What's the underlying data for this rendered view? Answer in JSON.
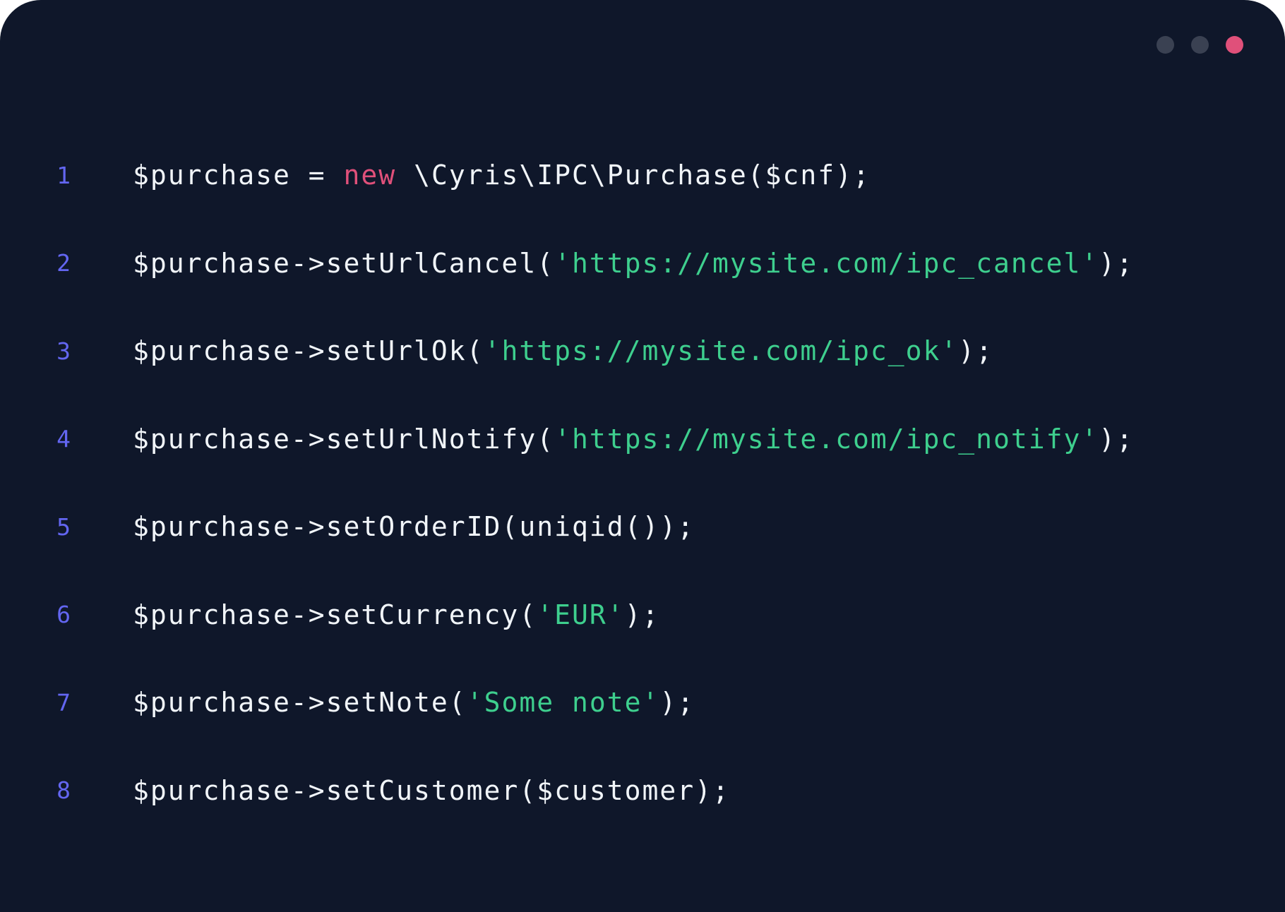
{
  "window_controls": [
    {
      "name": "minimize-dot",
      "color": "#3a4152"
    },
    {
      "name": "maximize-dot",
      "color": "#3a4152"
    },
    {
      "name": "close-dot",
      "color": "#e0507a"
    }
  ],
  "colors": {
    "background": "#0f172a",
    "line_number": "#6366f1",
    "default": "#f1f5f9",
    "keyword": "#e0507a",
    "string": "#3ecf8e"
  },
  "code": {
    "lines": [
      {
        "number": "1",
        "tokens": [
          {
            "text": "$purchase = ",
            "type": "default"
          },
          {
            "text": "new",
            "type": "keyword"
          },
          {
            "text": " \\Cyris\\IPC\\Purchase($cnf);",
            "type": "default"
          }
        ]
      },
      {
        "number": "2",
        "tokens": [
          {
            "text": "$purchase->setUrlCancel(",
            "type": "default"
          },
          {
            "text": "'https://mysite.com/ipc_cancel'",
            "type": "string"
          },
          {
            "text": ");",
            "type": "default"
          }
        ]
      },
      {
        "number": "3",
        "tokens": [
          {
            "text": "$purchase->setUrlOk(",
            "type": "default"
          },
          {
            "text": "'https://mysite.com/ipc_ok'",
            "type": "string"
          },
          {
            "text": ");",
            "type": "default"
          }
        ]
      },
      {
        "number": "4",
        "tokens": [
          {
            "text": "$purchase->setUrlNotify(",
            "type": "default"
          },
          {
            "text": "'https://mysite.com/ipc_notify'",
            "type": "string"
          },
          {
            "text": ");",
            "type": "default"
          }
        ]
      },
      {
        "number": "5",
        "tokens": [
          {
            "text": "$purchase->setOrderID(uniqid());",
            "type": "default"
          }
        ]
      },
      {
        "number": "6",
        "tokens": [
          {
            "text": "$purchase->setCurrency(",
            "type": "default"
          },
          {
            "text": "'EUR'",
            "type": "string"
          },
          {
            "text": ");",
            "type": "default"
          }
        ]
      },
      {
        "number": "7",
        "tokens": [
          {
            "text": "$purchase->setNote(",
            "type": "default"
          },
          {
            "text": "'Some note'",
            "type": "string"
          },
          {
            "text": ");",
            "type": "default"
          }
        ]
      },
      {
        "number": "8",
        "tokens": [
          {
            "text": "$purchase->setCustomer($customer);",
            "type": "default"
          }
        ]
      }
    ]
  }
}
